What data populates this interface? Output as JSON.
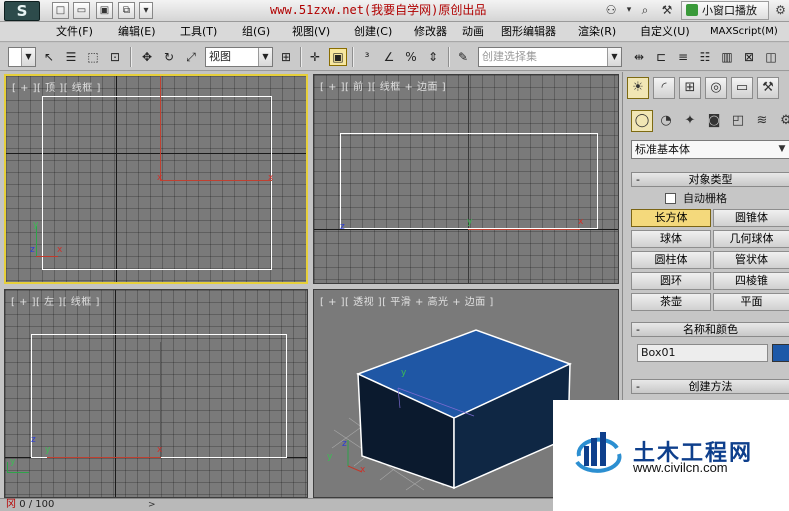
{
  "title_bar": {
    "app_logo_glyph": "S",
    "watermark": "www.51zxw.net(我要自学网)原创出品",
    "mini_window_label": "小窗口播放",
    "quick_access_icons": [
      "new-file-icon",
      "open-folder-icon",
      "save-icon",
      "project-icon",
      "dropdown-icon"
    ],
    "right_icons": [
      "binoculars-icon",
      "search-icon",
      "tools-icon"
    ]
  },
  "menu": {
    "items": [
      "文件(F)",
      "编辑(E)",
      "工具(T)",
      "组(G)",
      "视图(V)",
      "创建(C)",
      "修改器",
      "动画",
      "图形编辑器",
      "渲染(R)",
      "自定义(U)",
      "MAXScript(M)"
    ]
  },
  "toolbar": {
    "view_dropdown": "视图",
    "selection_set_placeholder": "创建选择集"
  },
  "viewports": {
    "top": {
      "label": "[ + ][ 顶 ][ 线框 ]"
    },
    "front": {
      "label": "[ + ][ 前 ][ 线框 + 边面 ]"
    },
    "left": {
      "label": "[ + ][ 左 ][ 线框 ]"
    },
    "perspective": {
      "label": "[ + ][ 透视 ][ 平滑 + 高光 + 边面 ]"
    },
    "axis_letters": {
      "x": "x",
      "y": "y",
      "z": "z"
    }
  },
  "command_panel": {
    "category": "标准基本体",
    "object_type": {
      "header": "对象类型",
      "autogrid_label": "自动栅格",
      "autogrid_checked": false,
      "buttons": [
        "长方体",
        "圆锥体",
        "球体",
        "几何球体",
        "圆柱体",
        "管状体",
        "圆环",
        "四棱锥",
        "茶壶",
        "平面"
      ],
      "selected": "长方体"
    },
    "name_color": {
      "header": "名称和颜色",
      "name_value": "Box01",
      "color": "#1c58a8"
    },
    "creation_method": {
      "header": "创建方法"
    }
  },
  "timeline": {
    "frame_display": "0 / 100",
    "frame_prefix_red": "冈"
  },
  "watermark_logo": {
    "title": "土木工程网",
    "url": "www.civilcn.com",
    "brand_color": "#0e3f8c"
  },
  "colors": {
    "active_viewport_border": "#e6cf3a",
    "box_top": "#1f57a5",
    "box_side_dark": "#0b1a2e",
    "axis_x": "#d0302a",
    "axis_y": "#3cbc55",
    "axis_z": "#2b3bd6"
  }
}
